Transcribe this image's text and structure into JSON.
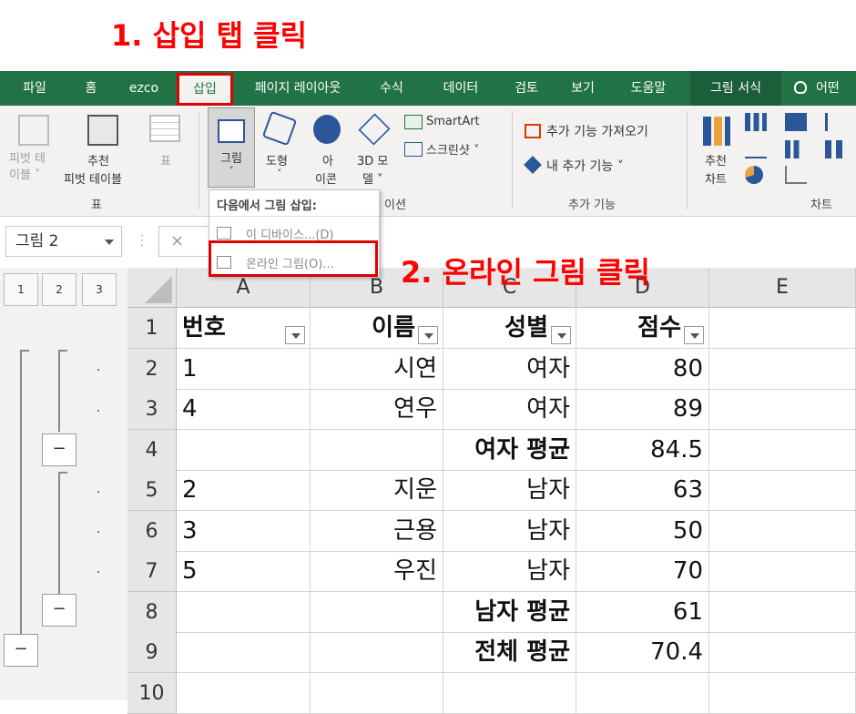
{
  "annotations": {
    "step1": "1. 삽입 탭 클릭",
    "step2": "2. 온라인 그림 클릭"
  },
  "ribbon_tabs": [
    "파일",
    "홈",
    "ezco",
    "삽입",
    "페이지 레이아웃",
    "수식",
    "데이터",
    "검토",
    "보기",
    "도움말",
    "그림 서식",
    "어떤"
  ],
  "active_tab": "삽입",
  "ribbon": {
    "pivot_table": "피벗 테\n이블 ˅",
    "recommended_pivot_1": "추천",
    "recommended_pivot_2": "피벗 테이블",
    "table": "표",
    "group_table": "표",
    "picture_1": "그림",
    "picture_2": "˅",
    "shapes_1": "도형",
    "shapes_2": "˅",
    "icons_1": "아",
    "icons_2": "이콘",
    "models_1": "3D 모",
    "models_2": "델 ˅",
    "smartart": "SmartArt",
    "screenshot": "스크린샷 ˅",
    "group_illust": "이션",
    "get_addins": "추가 기능 가져오기",
    "my_addins": "내 추가 기능 ˅",
    "group_addins": "추가 기능",
    "rec_charts_1": "추천",
    "rec_charts_2": "차트",
    "group_charts": "차트"
  },
  "dropdown": {
    "header": "다음에서 그림 삽입:",
    "item_device": "이 디바이스...(D)",
    "item_online": "온라인 그림(O)..."
  },
  "namebox": "그림 2",
  "formula_x": "×",
  "outline_levels": [
    "1",
    "2",
    "3"
  ],
  "outline_minus": "−",
  "columns": [
    "A",
    "B",
    "C",
    "D",
    "E"
  ],
  "rows": [
    {
      "num": "1",
      "a": "번호",
      "b": "이름",
      "c": "성별",
      "d": "점수"
    },
    {
      "num": "2",
      "a": "1",
      "b": "시연",
      "c": "여자",
      "d": "80"
    },
    {
      "num": "3",
      "a": "4",
      "b": "연우",
      "c": "여자",
      "d": "89"
    },
    {
      "num": "4",
      "a": "",
      "b": "",
      "c": "여자 평균",
      "d": "84.5"
    },
    {
      "num": "5",
      "a": "2",
      "b": "지운",
      "c": "남자",
      "d": "63"
    },
    {
      "num": "6",
      "a": "3",
      "b": "근용",
      "c": "남자",
      "d": "50"
    },
    {
      "num": "7",
      "a": "5",
      "b": "우진",
      "c": "남자",
      "d": "70"
    },
    {
      "num": "8",
      "a": "",
      "b": "",
      "c": "남자 평균",
      "d": "61"
    },
    {
      "num": "9",
      "a": "",
      "b": "",
      "c": "전체 평균",
      "d": "70.4"
    },
    {
      "num": "10",
      "a": "",
      "b": "",
      "c": "",
      "d": ""
    }
  ],
  "colors": {
    "excel_green": "#217346",
    "annotation_red": "#ff0000"
  }
}
